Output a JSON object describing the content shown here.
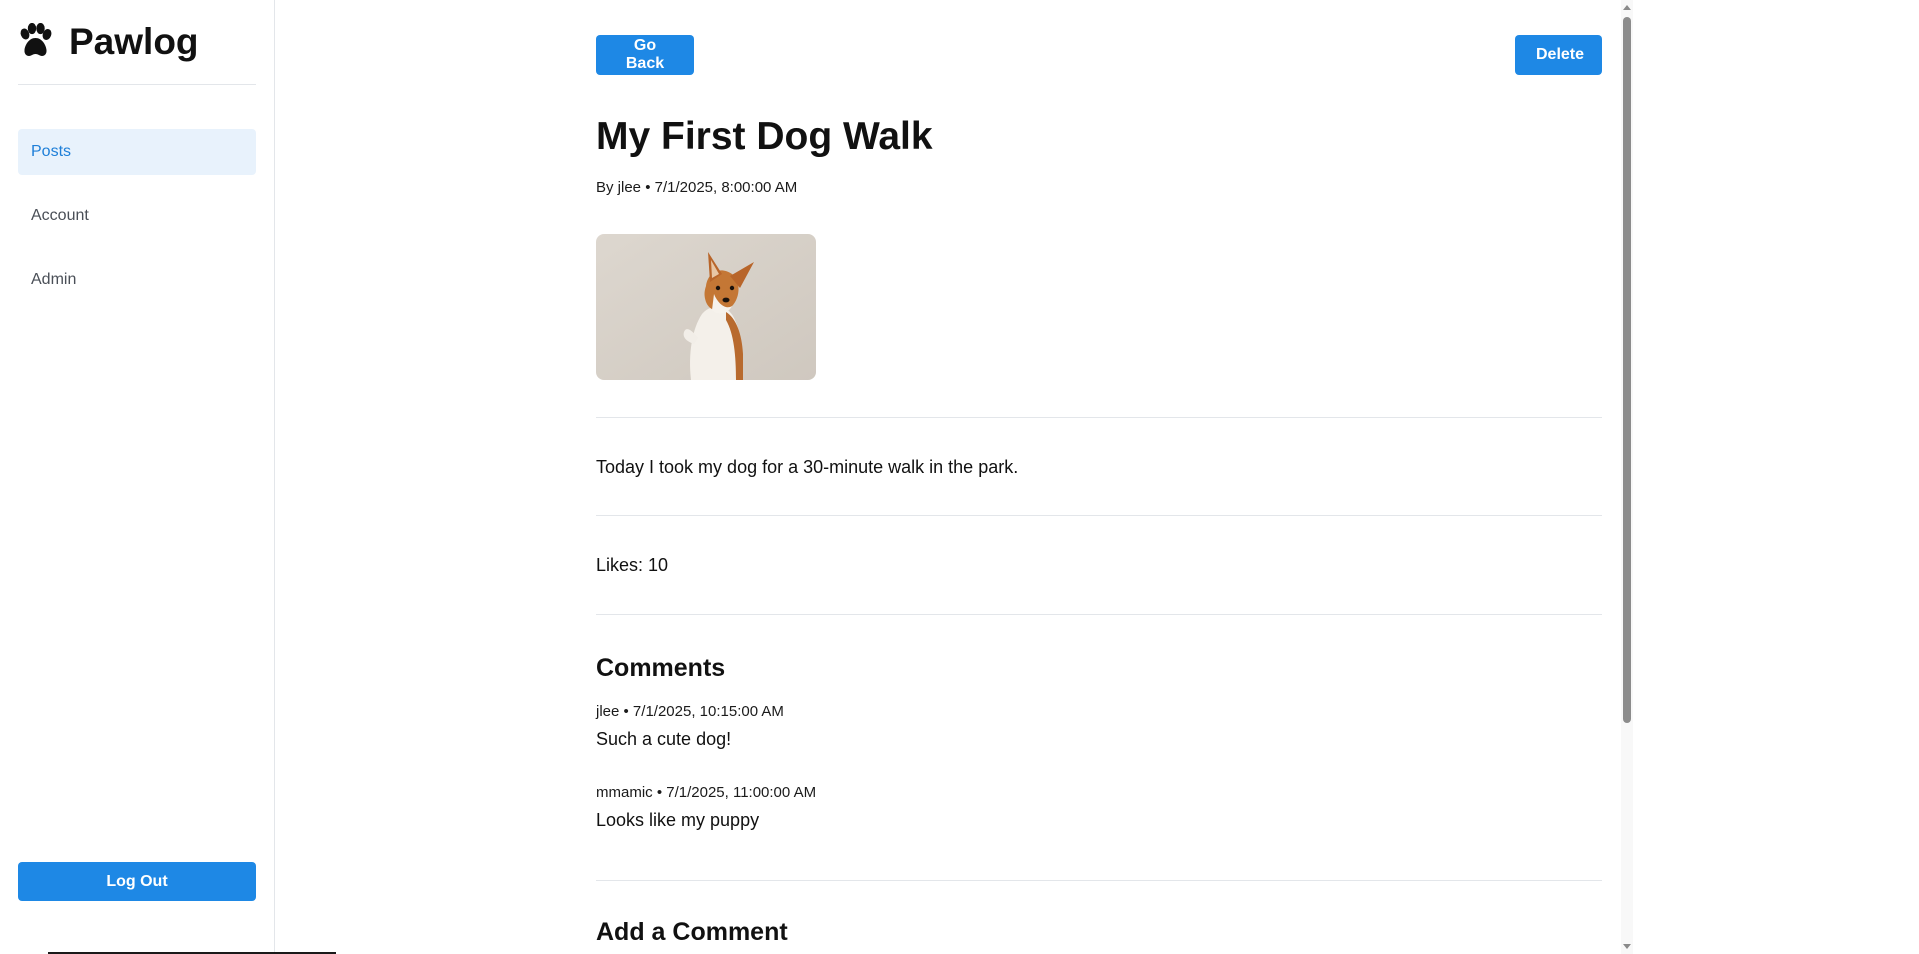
{
  "sidebar": {
    "brand": {
      "icon": "paw-icon",
      "title": "Pawlog"
    },
    "items": [
      {
        "label": "Posts",
        "active": true
      },
      {
        "label": "Account",
        "active": false
      },
      {
        "label": "Admin",
        "active": false
      }
    ],
    "logout_label": "Log Out"
  },
  "toolbar": {
    "back_label": "Go Back",
    "delete_label": "Delete"
  },
  "post": {
    "title": "My First Dog Walk",
    "meta": "By jlee • 7/1/2025, 8:00:00 AM",
    "image": {
      "subject": "dog-photo"
    },
    "body": "Today I took my dog for a 30-minute walk in the park.",
    "likes_label": "Likes:",
    "likes_value": "10"
  },
  "comments": {
    "heading": "Comments",
    "items": [
      {
        "meta": "jlee • 7/1/2025, 10:15:00 AM",
        "text": "Such a cute dog!"
      },
      {
        "meta": "mmamic • 7/1/2025, 11:00:00 AM",
        "text": "Looks like my puppy"
      }
    ]
  },
  "add_comment": {
    "heading": "Add a Comment"
  },
  "colors": {
    "accent": "#1e88e5",
    "active_bg": "#e8f2fc",
    "active_text": "#1e7fd8"
  }
}
